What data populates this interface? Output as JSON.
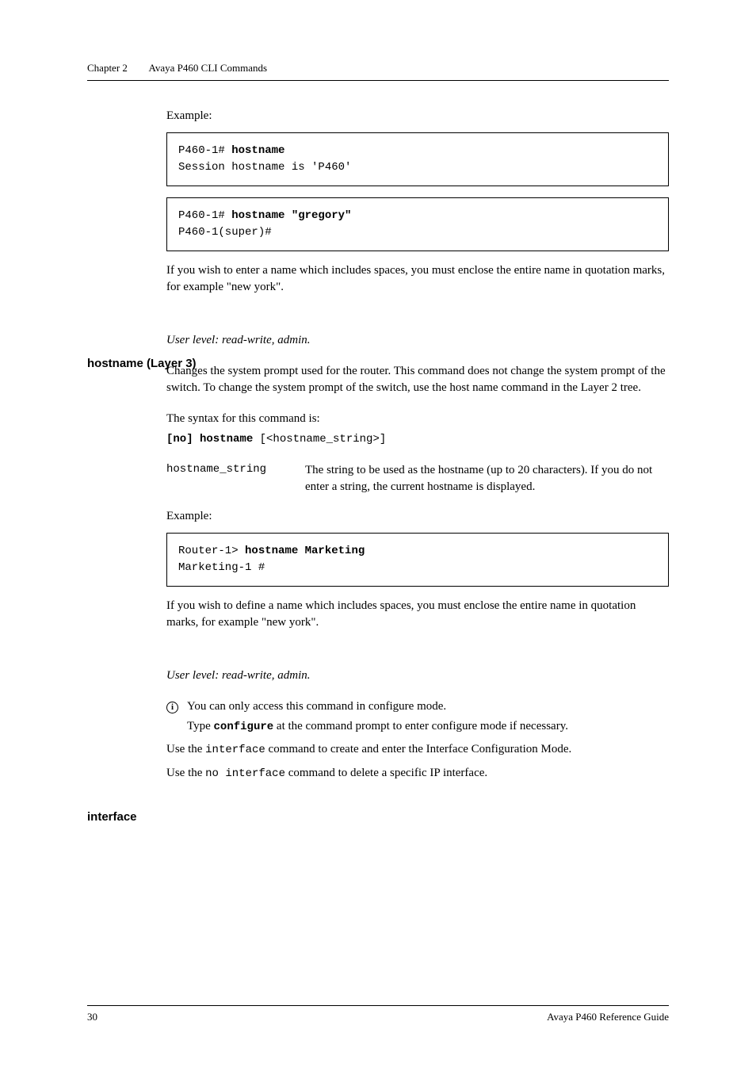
{
  "header": {
    "chapter": "Chapter 2",
    "title": "Avaya P460 CLI Commands"
  },
  "sec1": {
    "example_label": "Example:",
    "code1_line1_pre": "P460-1# ",
    "code1_line1_cmd": "hostname",
    "code1_line2": "Session hostname is 'P460'",
    "code2_line1_pre": "P460-1# ",
    "code2_line1_cmd": "hostname \"gregory\"",
    "code2_line2": "P460-1(super)#",
    "note": "If you wish to enter a name which includes spaces, you must enclose the entire name in quotation marks, for example \"new york\"."
  },
  "sec2": {
    "heading": "hostname (Layer 3)",
    "userlevel": "User level: read-write, admin.",
    "desc": "Changes the system prompt used for the router. This command does not change the system prompt of the switch. To change the system prompt of the switch, use the host name command in the Layer 2 tree.",
    "syntax_label": "The syntax for this command is:",
    "syntax_cmd": "[no] hostname",
    "syntax_arg": " [<hostname_string>]",
    "param_name": "hostname_string",
    "param_desc": "The string to be used as the hostname (up to 20 characters). If you do not enter a string, the current hostname is displayed.",
    "example_label": "Example:",
    "code_line1_pre": "Router-1> ",
    "code_line1_cmd": "hostname Marketing",
    "code_line2": "Marketing-1 #",
    "note": "If you wish to define a name which includes spaces, you must enclose the entire name in quotation marks, for example \"new york\"."
  },
  "sec3": {
    "heading": "interface",
    "userlevel": "User level: read-write, admin.",
    "info_icon": "i",
    "info1": "You can only access this command in configure mode.",
    "info2_pre": "Type ",
    "info2_cmd": "configure",
    "info2_post": " at the command prompt to enter configure mode if necessary.",
    "p1_pre": "Use the ",
    "p1_code": "interface",
    "p1_post": " command to create and enter the Interface Configuration Mode.",
    "p2_pre": "Use the ",
    "p2_code": "no interface",
    "p2_post": " command to delete a specific IP interface."
  },
  "footer": {
    "page": "30",
    "book": "Avaya P460 Reference Guide"
  }
}
